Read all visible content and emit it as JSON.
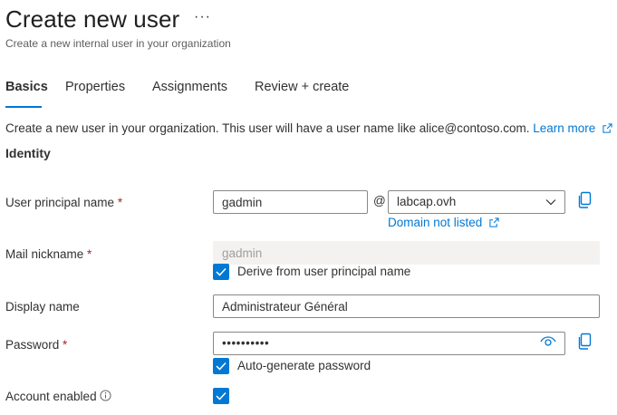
{
  "header": {
    "title": "Create new user",
    "more": "···",
    "subtitle": "Create a new internal user in your organization"
  },
  "tabs": [
    {
      "label": "Basics",
      "active": true
    },
    {
      "label": "Properties",
      "active": false
    },
    {
      "label": "Assignments",
      "active": false
    },
    {
      "label": "Review + create",
      "active": false
    }
  ],
  "intro": {
    "text": "Create a new user in your organization. This user will have a user name like alice@contoso.com.",
    "learn_more": "Learn more"
  },
  "section": {
    "identity": "Identity"
  },
  "form": {
    "upn": {
      "label": "User principal name",
      "required": "*",
      "value": "gadmin",
      "at": "@",
      "domain": "labcap.ovh",
      "domain_not_listed": "Domain not listed"
    },
    "mail_nickname": {
      "label": "Mail nickname",
      "required": "*",
      "value": "gadmin",
      "derive_label": "Derive from user principal name",
      "derive_checked": true
    },
    "display_name": {
      "label": "Display name",
      "value": "Administrateur Général"
    },
    "password": {
      "label": "Password",
      "required": "*",
      "value": "••••••••••",
      "autogen_label": "Auto-generate password",
      "autogen_checked": true
    },
    "account_enabled": {
      "label": "Account enabled",
      "checked": true
    }
  },
  "icons": {
    "copy": "copy-icon",
    "eye": "eye-icon",
    "chevron": "chevron-down-icon",
    "external": "external-link-icon",
    "info": "info-icon",
    "check": "checkmark-icon"
  },
  "colors": {
    "accent": "#0078d4",
    "required": "#a4262c",
    "text": "#323130",
    "disabled_bg": "#f3f2f1"
  }
}
